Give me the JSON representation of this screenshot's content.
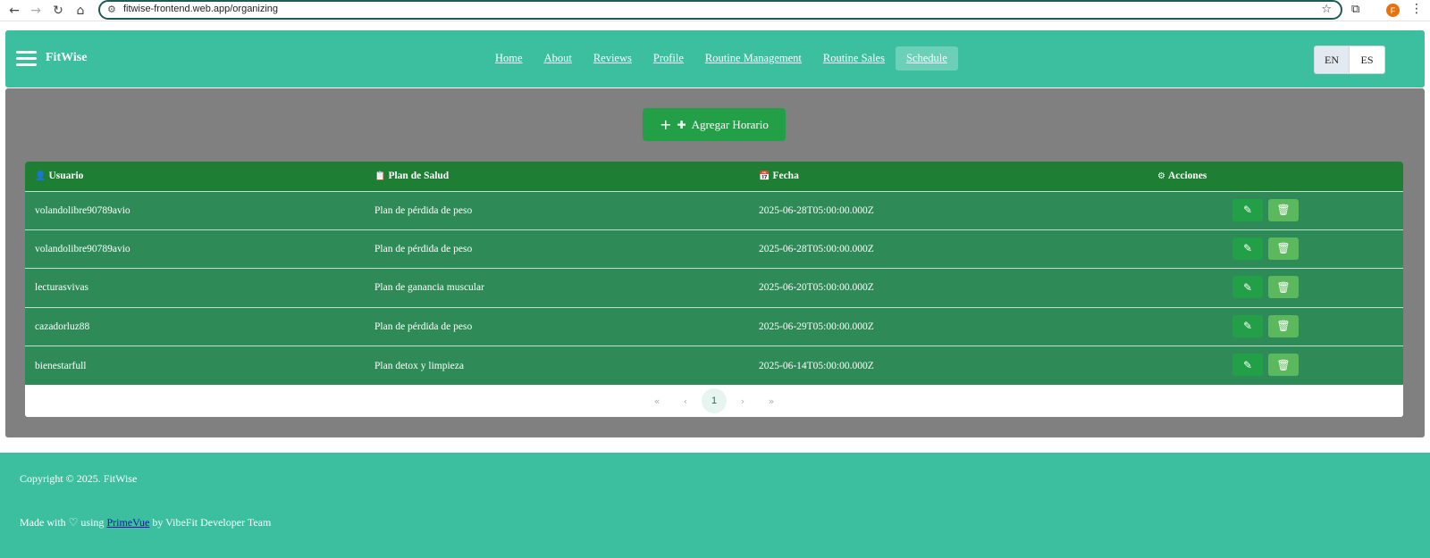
{
  "browser": {
    "url": "fitwise-frontend.web.app/organizing",
    "profile_initial": "F"
  },
  "header": {
    "brand": "FitWise",
    "nav": [
      {
        "label": "Home"
      },
      {
        "label": "About"
      },
      {
        "label": "Reviews"
      },
      {
        "label": "Profile"
      },
      {
        "label": "Routine Management"
      },
      {
        "label": "Routine Sales"
      },
      {
        "label": "Schedule",
        "active": true
      }
    ],
    "languages": [
      "EN",
      "ES"
    ],
    "selected_language": "EN"
  },
  "main": {
    "add_button_label": "Agregar Horario",
    "table": {
      "columns": [
        "Usuario",
        "Plan de Salud",
        "Fecha",
        "Acciones"
      ],
      "column_icons": [
        "user-icon",
        "clipboard-icon",
        "calendar-icon",
        "gear-icon"
      ],
      "rows": [
        {
          "user": "volandolibre90789avio",
          "plan": "Plan de pérdida de peso",
          "date": "2025-06-28T05:00:00.000Z"
        },
        {
          "user": "volandolibre90789avio",
          "plan": "Plan de pérdida de peso",
          "date": "2025-06-28T05:00:00.000Z"
        },
        {
          "user": "lecturasvivas",
          "plan": "Plan de ganancia muscular",
          "date": "2025-06-20T05:00:00.000Z"
        },
        {
          "user": "cazadorluz88",
          "plan": "Plan de pérdida de peso",
          "date": "2025-06-29T05:00:00.000Z"
        },
        {
          "user": "bienestarfull",
          "plan": "Plan detox y limpieza",
          "date": "2025-06-14T05:00:00.000Z"
        }
      ]
    },
    "pagination": {
      "current_page": "1"
    }
  },
  "footer": {
    "copyright": "Copyright © 2025. FitWise",
    "made_with_prefix": "Made with",
    "made_with_using": "using",
    "made_with_link": "PrimeVue",
    "made_with_suffix": "by VibeFit Developer Team"
  },
  "colors": {
    "header_bg": "#3bbf9f",
    "content_bg": "#808080",
    "table_head_bg": "#1e7e34",
    "table_row_bg": "#2e8b57",
    "add_button_bg": "#23a047",
    "delete_button_bg": "#5cb85c"
  }
}
